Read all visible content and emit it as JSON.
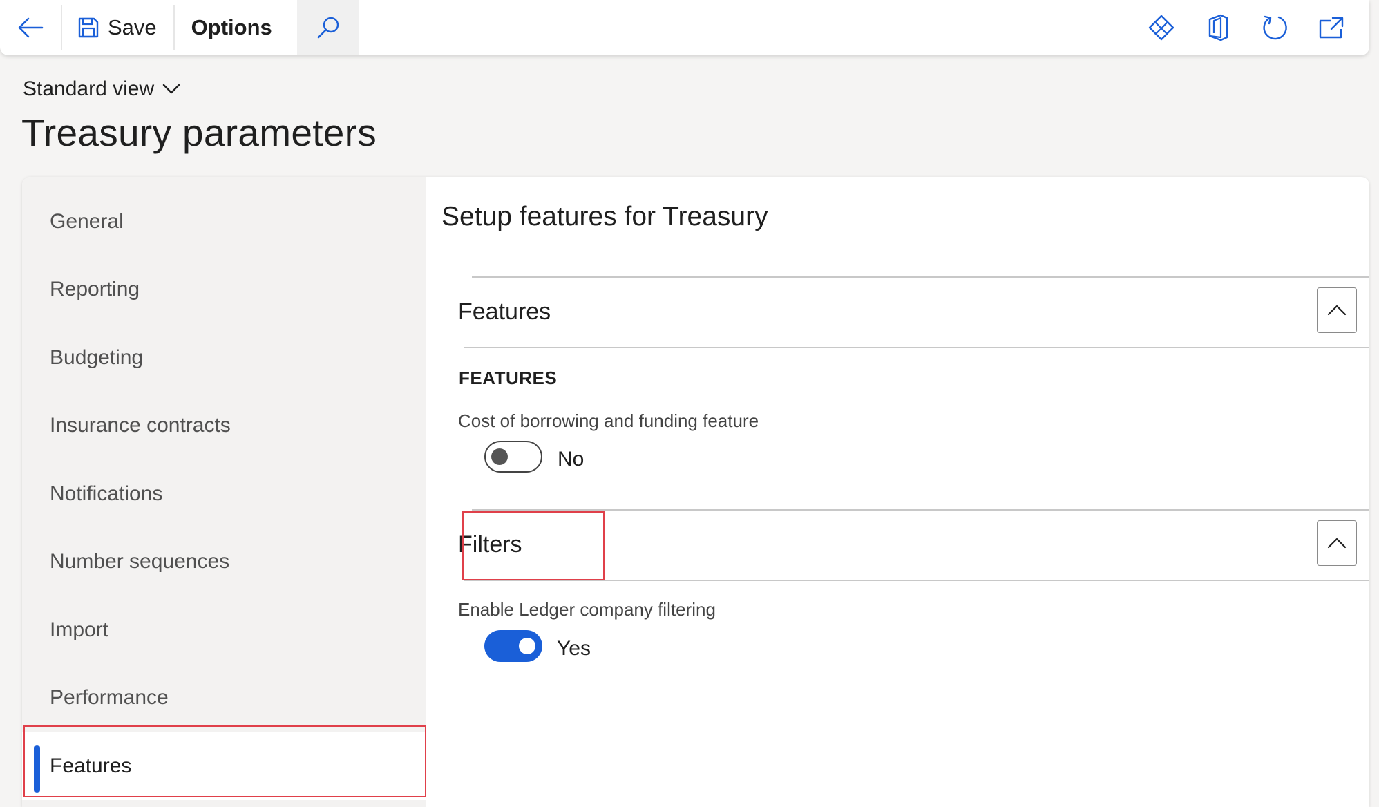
{
  "toolbar": {
    "save_label": "Save",
    "options_label": "Options"
  },
  "header": {
    "view_label": "Standard view",
    "title": "Treasury parameters"
  },
  "nav": {
    "items": [
      {
        "label": "General"
      },
      {
        "label": "Reporting"
      },
      {
        "label": "Budgeting"
      },
      {
        "label": "Insurance contracts"
      },
      {
        "label": "Notifications"
      },
      {
        "label": "Number sequences"
      },
      {
        "label": "Import"
      },
      {
        "label": "Performance"
      },
      {
        "label": "Features",
        "active": true
      }
    ]
  },
  "content": {
    "title": "Setup features for Treasury",
    "sections": [
      {
        "title": "Features",
        "group_label": "FEATURES",
        "field_label": "Cost of borrowing and funding feature",
        "toggle_value": "No",
        "toggle_on": false
      },
      {
        "title": "Filters",
        "field_label": "Enable Ledger company filtering",
        "toggle_value": "Yes",
        "toggle_on": true
      }
    ]
  },
  "colors": {
    "accent": "#1a5fd8",
    "highlight": "#e0404a"
  }
}
